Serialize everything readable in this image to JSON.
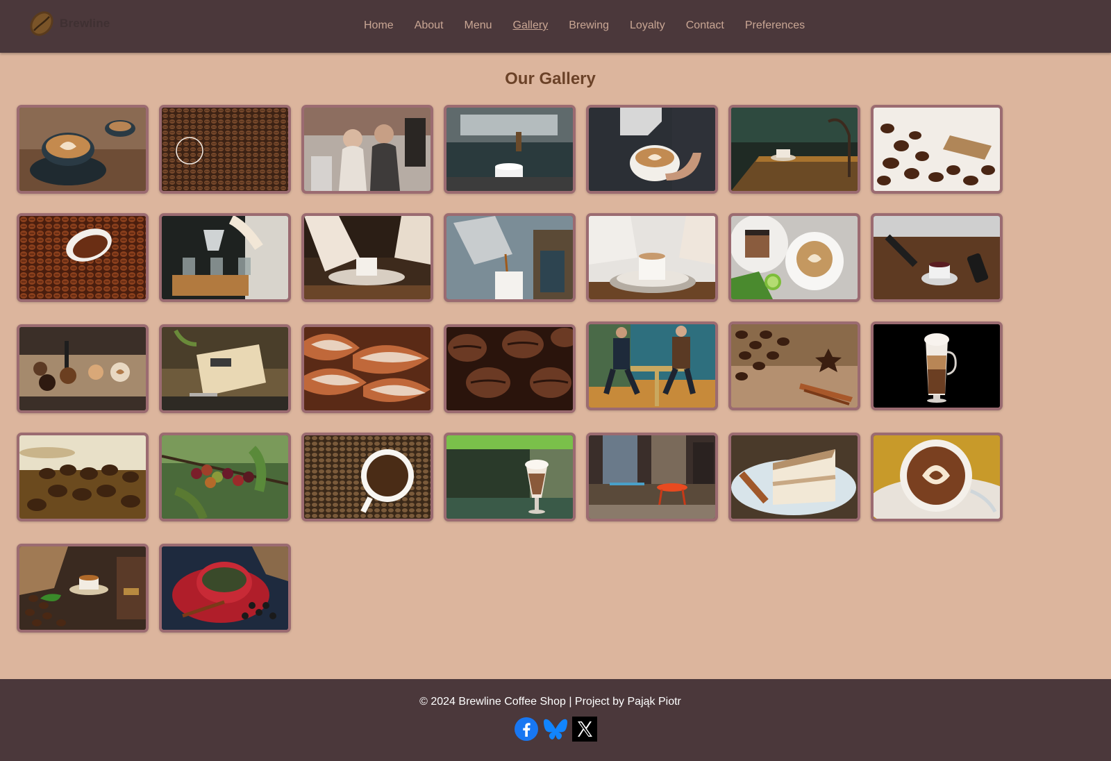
{
  "header": {
    "brand": "Brewline",
    "nav": [
      "Home",
      "About",
      "Menu",
      "Gallery",
      "Brewing",
      "Loyalty",
      "Contact",
      "Preferences"
    ],
    "active_nav": "Gallery"
  },
  "main": {
    "title": "Our Gallery",
    "photos": [
      {
        "alt": "latte art cups on table"
      },
      {
        "alt": "coffee beans"
      },
      {
        "alt": "couple in cafe"
      },
      {
        "alt": "espresso machine pouring"
      },
      {
        "alt": "pouring latte art"
      },
      {
        "alt": "cafe table with cup"
      },
      {
        "alt": "coffee beans with scoop"
      },
      {
        "alt": "cup spilling beans"
      },
      {
        "alt": "barista pour over"
      },
      {
        "alt": "woman with coffee cup"
      },
      {
        "alt": "moka pot pouring"
      },
      {
        "alt": "hands with cappuccino"
      },
      {
        "alt": "latte with cake"
      },
      {
        "alt": "pouring coffee on table"
      },
      {
        "alt": "coffee tray with portafilter"
      },
      {
        "alt": "espresso machine in cafe"
      },
      {
        "alt": "croissants"
      },
      {
        "alt": "roasted beans close-up"
      },
      {
        "alt": "people sitting at cafe table"
      },
      {
        "alt": "beans with cinnamon and anise"
      },
      {
        "alt": "layered latte macchiato"
      },
      {
        "alt": "beans with star anise"
      },
      {
        "alt": "coffee cherries on branch"
      },
      {
        "alt": "cup on coffee beans"
      },
      {
        "alt": "iced coffee glass"
      },
      {
        "alt": "cafe terrace with red table"
      },
      {
        "alt": "cake slice with cinnamon"
      },
      {
        "alt": "cappuccino heart latte art"
      },
      {
        "alt": "espresso with coffee grinder"
      },
      {
        "alt": "red cup with coffee and beans"
      }
    ]
  },
  "footer": {
    "copyright": "© 2024 Brewline Coffee Shop | Project by Pająk Piotr",
    "social": [
      {
        "icon": "facebook-icon"
      },
      {
        "icon": "bluesky-icon"
      },
      {
        "icon": "x-icon"
      }
    ]
  },
  "colors": {
    "header_bg": "#4b383b",
    "page_bg": "#dcb59d",
    "nav_text": "#c9a694",
    "title": "#6b4228",
    "tile_border": "#9b6b71"
  }
}
